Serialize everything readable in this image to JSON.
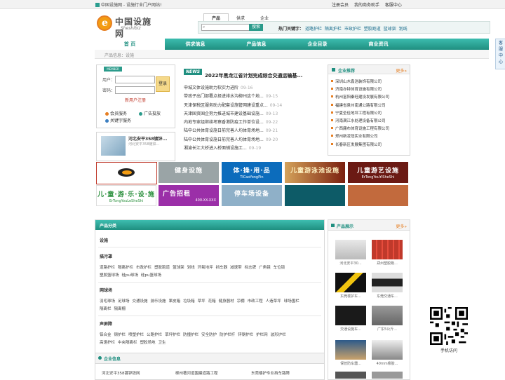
{
  "topbar": {
    "site_title": "中国设施网 - 设施行业门户网站!",
    "links": [
      "注册会员",
      "我的商务助手",
      "客服中心"
    ]
  },
  "logo": {
    "cn": "中国设施网",
    "en": "Sheshibiz",
    "mark": "e"
  },
  "search": {
    "tabs": [
      "产品",
      "供求",
      "企业"
    ],
    "placeholder": "",
    "button": "搜索",
    "hot_label": "热门关键字：",
    "hot_keywords": [
      "道路护栏",
      "隔离护栏",
      "市政护栏",
      "塑胶跑道",
      "篮球架",
      "划线"
    ]
  },
  "nav": {
    "items": [
      "首 页",
      "供求信息",
      "产品信息",
      "企业目录",
      "商业资讯"
    ],
    "active_index": 0,
    "breadcrumb": "产品信息：设施"
  },
  "login": {
    "badge": "MEMBER",
    "user_label": "用户：",
    "pass_label": "密码：",
    "login_button": "登录",
    "register": "新用户注册",
    "services": [
      "会员服务",
      "广告投放",
      "关键字服务"
    ]
  },
  "ad_thumb": {
    "title": "河北安平358镀锌...",
    "sub": "河北安平358镀锌..."
  },
  "news": {
    "logo": "NEWS",
    "headline": "2022年黑龙江省计划完成综合交通运输基...",
    "items": [
      {
        "title": "申城文体设施助力软实力进阶",
        "date": "09-16"
      },
      {
        "title": "带孩子出门部署点择进排水沟柳州这个地...",
        "date": "09-15"
      },
      {
        "title": "天津保税区服务助力配套设施管网建设重点...",
        "date": "09-14"
      },
      {
        "title": "天津国资国企努力推进城市建设基础设施...",
        "date": "09-13"
      },
      {
        "title": "内地专家组继续考察香港防疫工作单位设...",
        "date": "09-22"
      },
      {
        "title": "陆中公共体育设施日前完善人均体育场地...",
        "date": "09-21"
      },
      {
        "title": "陆中公共体育设施日前完善人均体育场地...",
        "date": "09-20"
      },
      {
        "title": "湘渝长江大桥进入桥面铺设施工...",
        "date": "09-19"
      }
    ]
  },
  "companies": {
    "title": "企业推荐",
    "more": "更多»",
    "items": [
      "深圳山木鑫浩装饰有限公司",
      "济南亦特体育设施有限公司",
      "杭州富阳秦旺建设发展有限公司",
      "福建省泉州南通公路有限公司",
      "宁夏圣佳地坪工程有限公司",
      "河南满江水处理设备有限公司",
      "广西庸布体育设施工程有限公司",
      "郑州新凌冠实业有限公司",
      "长春新区发展集团有限公司"
    ]
  },
  "side_float": "客服中心",
  "banners": [
    {
      "title": "",
      "sub": "",
      "color": "#ffffff"
    },
    {
      "title": "健身设施",
      "sub": "",
      "color": "#9aa4a6"
    },
    {
      "title": "体·操·用·品",
      "sub": "TiCaoYongPin",
      "color": "#0c6cbc"
    },
    {
      "title": "儿童游泳池设施",
      "sub": "",
      "color": "#7a1f0f"
    },
    {
      "title": "儿童游艺设施",
      "sub": "ErTongYouYiSheShi",
      "color": "#6b1a14"
    },
    {
      "title": "儿·童·游·乐·设·施",
      "sub": "ErTongYouLeSheShi",
      "color": "#ffffff"
    },
    {
      "title": "广告招租",
      "sub": "400-XX-XXX",
      "color": "#9b2fa8"
    },
    {
      "title": "停车场设备",
      "sub": "",
      "color": "#8fb0c8"
    },
    {
      "title": "",
      "sub": "",
      "color": "#0d5b67"
    },
    {
      "title": "",
      "sub": "",
      "color": "#c26a3d"
    }
  ],
  "categories": {
    "title": "产品分类",
    "groups": [
      {
        "name": "设施",
        "rows": []
      },
      {
        "name": "描污罩",
        "rows": [
          [
            "道路护栏",
            "隔离护栏",
            "市政护栏",
            "塑胶跑道",
            "篮球架",
            "划线",
            "环氧地坪",
            "挡车器",
            "减速带",
            "标志牌",
            "广角镜",
            "车位锁"
          ],
          [
            "塑胶篮球场",
            "硅pu球场",
            "硅pu篮球场"
          ]
        ]
      },
      {
        "name": "网球场",
        "rows": [
          [
            "羽毛球场",
            "足球场",
            "交通设施",
            "游乐设施",
            "果皮箱",
            "垃圾箱",
            "草坪",
            "花箱",
            "健身器材",
            "凉棚",
            "市政工程",
            "人造草坪",
            "球场围栏"
          ],
          [
            "隔离栏",
            "隔离栅"
          ]
        ]
      },
      {
        "name": "声屏障",
        "rows": [
          [
            "铝合金",
            "钢护栏",
            "喷塑护栏",
            "公路护栏",
            "草坪护栏",
            "防撞护栏",
            "安全防护",
            "防护栏杆",
            "锌钢护栏",
            "护栏网",
            "波形护栏"
          ],
          [
            "高速护栏",
            "中央隔离栏",
            "塑胶场地",
            "卫生"
          ]
        ]
      }
    ]
  },
  "enterprise": {
    "title": "企业信息",
    "items": [
      "河北安平358镀锌铁网",
      "柳州著河道围建道路工程",
      "东莞楼护专业挡车路障"
    ]
  },
  "products": {
    "title": "产品展示",
    "more": "更多»",
    "items": [
      "河北安平30...",
      "郑州塑胶跑...",
      "东莞楼护车...",
      "东莞交通车...",
      "",
      "广东5公斤...",
      "交通设施车...",
      "",
      "保管防车器...",
      "40mm橡胶...",
      "",
      ""
    ]
  },
  "qr": {
    "caption": "手机访问"
  }
}
